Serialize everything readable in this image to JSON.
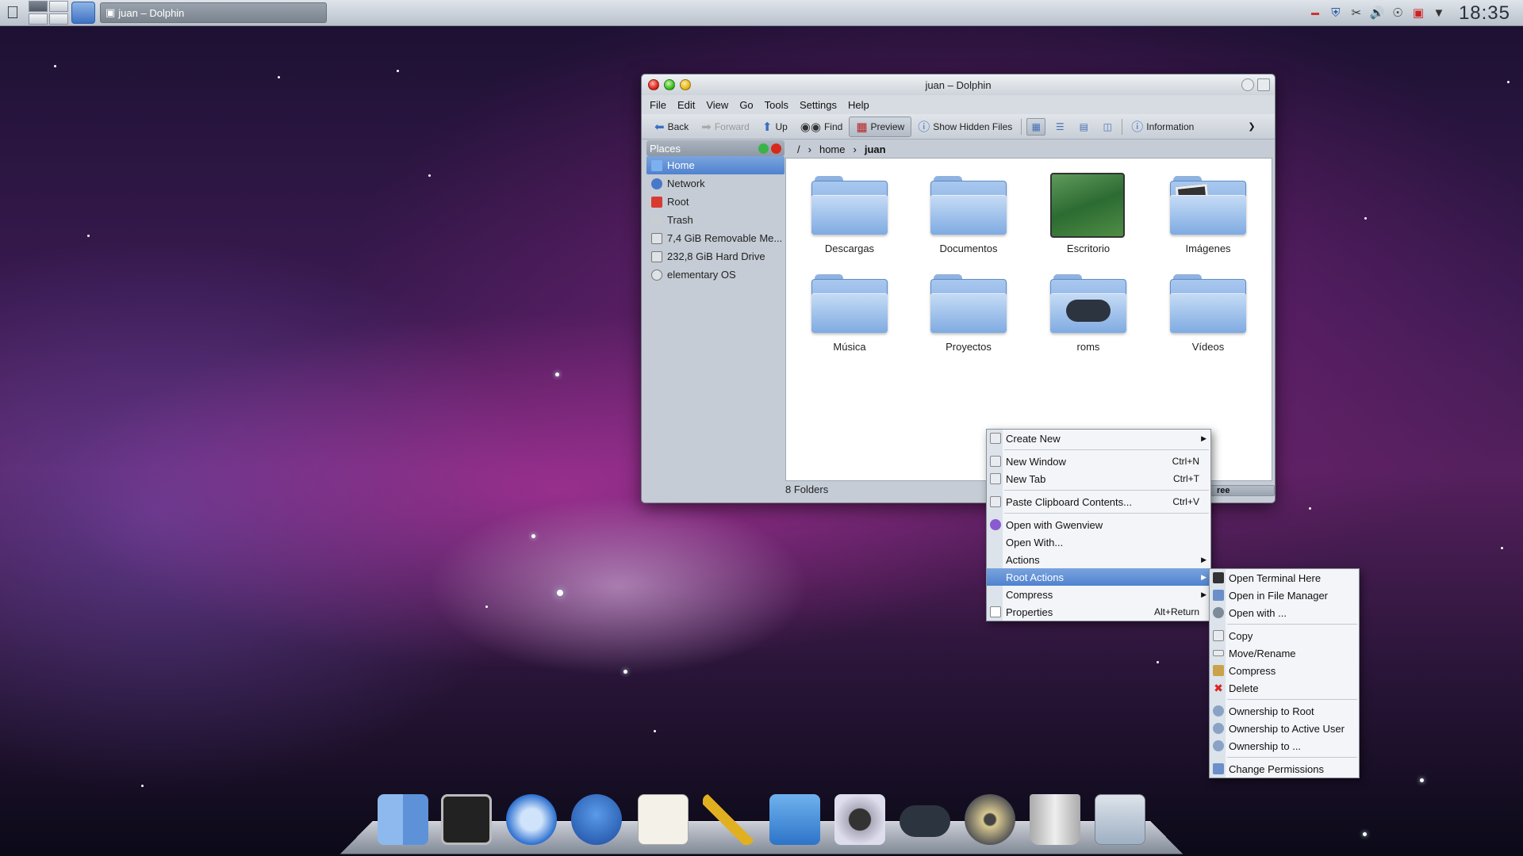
{
  "taskbar": {
    "task_label": "juan – Dolphin",
    "clock": "18:35"
  },
  "window": {
    "title": "juan – Dolphin",
    "menu": [
      "File",
      "Edit",
      "View",
      "Go",
      "Tools",
      "Settings",
      "Help"
    ],
    "toolbar": {
      "back": "Back",
      "forward": "Forward",
      "up": "Up",
      "find": "Find",
      "preview": "Preview",
      "hidden": "Show Hidden Files",
      "information": "Information"
    },
    "places": {
      "header": "Places",
      "items": [
        {
          "label": "Home",
          "icon": "home-icon"
        },
        {
          "label": "Network",
          "icon": "network-icon"
        },
        {
          "label": "Root",
          "icon": "root-folder-icon"
        },
        {
          "label": "Trash",
          "icon": "trash-icon"
        },
        {
          "label": "7,4 GiB Removable Me...",
          "icon": "removable-drive-icon"
        },
        {
          "label": "232,8 GiB Hard Drive",
          "icon": "hard-drive-icon"
        },
        {
          "label": "elementary OS",
          "icon": "disk-icon"
        }
      ]
    },
    "breadcrumb": {
      "root": "/",
      "home": "home",
      "current": "juan"
    },
    "files": [
      {
        "name": "Descargas",
        "icon": "folder-icon"
      },
      {
        "name": "Documentos",
        "icon": "folder-icon"
      },
      {
        "name": "Escritorio",
        "icon": "desktop-folder-icon"
      },
      {
        "name": "Imágenes",
        "icon": "pictures-folder-icon"
      },
      {
        "name": "Música",
        "icon": "folder-icon"
      },
      {
        "name": "Proyectos",
        "icon": "folder-icon"
      },
      {
        "name": "roms",
        "icon": "gamepad-folder-icon"
      },
      {
        "name": "Vídeos",
        "icon": "folder-icon"
      }
    ],
    "status": "8 Folders",
    "status_right": "ree"
  },
  "context_menu": [
    {
      "label": "Create New",
      "submenu": true
    },
    {
      "label": "New Window",
      "shortcut": "Ctrl+N"
    },
    {
      "label": "New Tab",
      "shortcut": "Ctrl+T"
    },
    {
      "label": "Paste Clipboard Contents...",
      "shortcut": "Ctrl+V"
    },
    {
      "label": "Open with Gwenview"
    },
    {
      "label": "Open With..."
    },
    {
      "label": "Actions",
      "submenu": true
    },
    {
      "label": "Root Actions",
      "submenu": true
    },
    {
      "label": "Compress",
      "submenu": true
    },
    {
      "label": "Properties",
      "shortcut": "Alt+Return"
    }
  ],
  "root_actions_menu": [
    "Open Terminal Here",
    "Open in File Manager",
    "Open with ...",
    "Copy",
    "Move/Rename",
    "Compress",
    "Delete",
    "Ownership to Root",
    "Ownership to Active User",
    "Ownership to ...",
    "Change Permissions"
  ]
}
